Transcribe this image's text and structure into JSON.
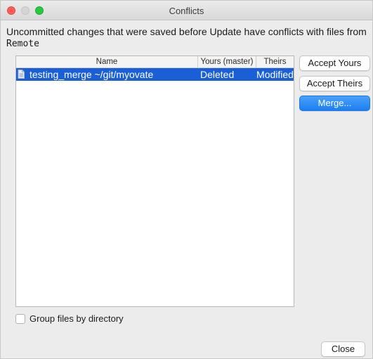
{
  "window": {
    "title": "Conflicts"
  },
  "message": {
    "text": "Uncommitted changes that were saved before Update have conflicts with files from",
    "source": "Remote"
  },
  "table": {
    "columns": [
      "Name",
      "Yours (master)",
      "Theirs"
    ],
    "rows": [
      {
        "name": "testing_merge  ~/git/myovate",
        "yours": "Deleted",
        "theirs": "Modified",
        "selected": true,
        "icon": "file-icon"
      }
    ]
  },
  "buttons": {
    "accept_yours": "Accept Yours",
    "accept_theirs": "Accept Theirs",
    "merge": "Merge...",
    "close": "Close"
  },
  "options": {
    "group_by_directory": {
      "label": "Group files by directory",
      "checked": false
    }
  },
  "colors": {
    "selection": "#1a5fd6",
    "primary_button": "#1b7ff2"
  }
}
